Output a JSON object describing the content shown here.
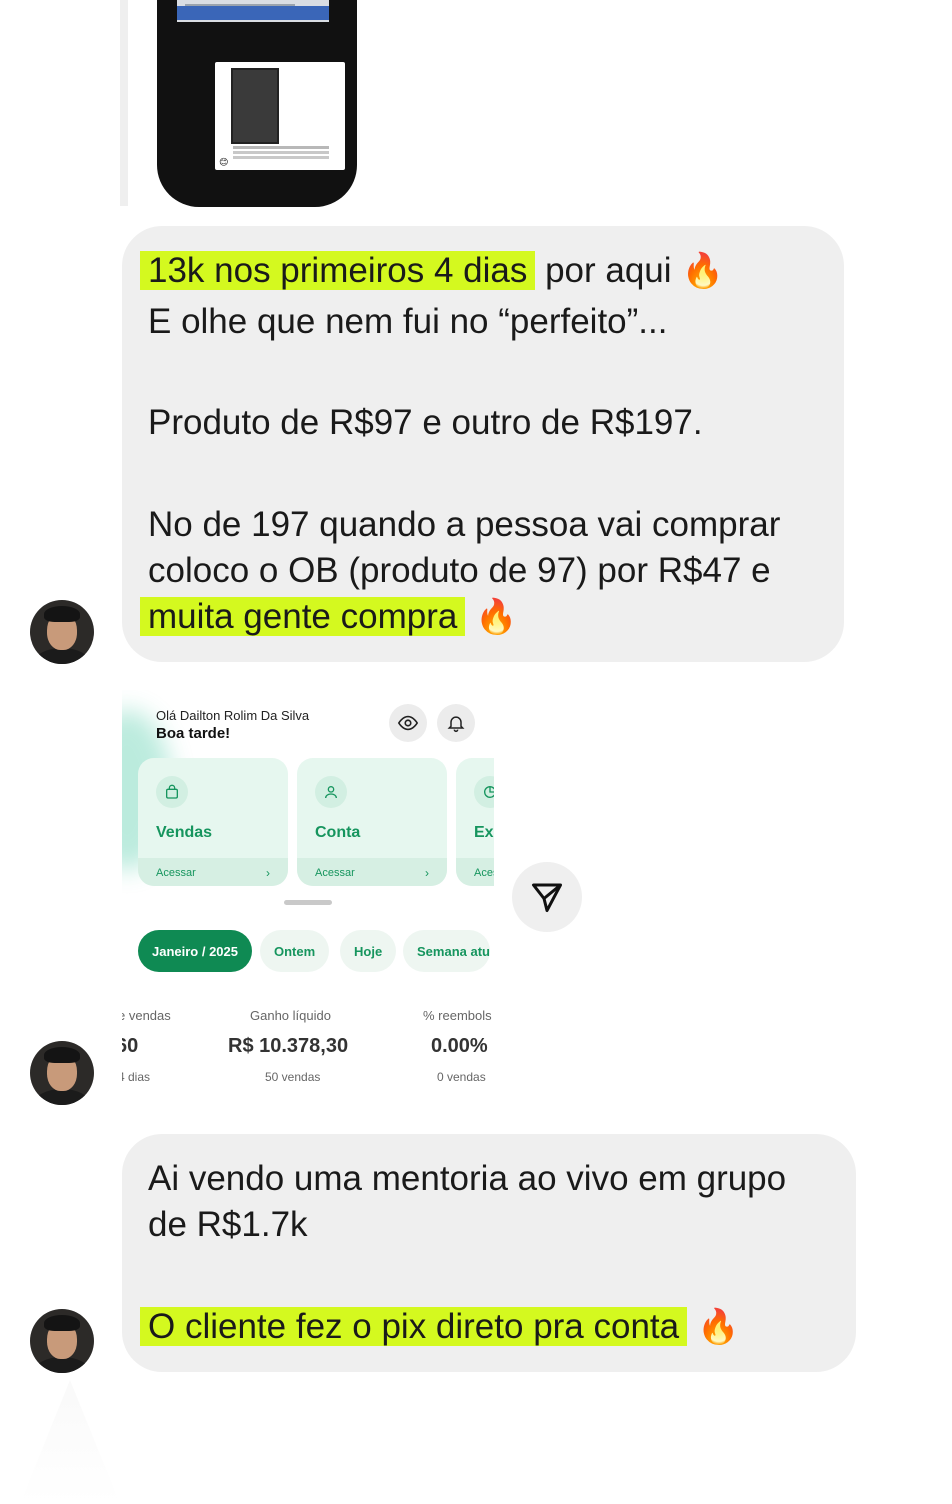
{
  "messages": {
    "m1": {
      "line1_highlight": "13k nos primeiros 4 dias",
      "line1_rest": " por aqui",
      "line2": "E olhe que nem fui no “perfeito”...",
      "line3": "Produto de R$97 e outro de R$197.",
      "line4": "No de 197 quando a pessoa vai comprar",
      "line5": "coloco o OB (produto de 97) por R$47 e",
      "line6_highlight": "muita gente compra",
      "fire_emoji": "🔥"
    },
    "m3": {
      "line1": "Ai vendo uma mentoria ao vivo em grupo",
      "line2": "de R$1.7k",
      "line3_highlight": "O cliente fez o pix direto pra conta",
      "fire_emoji": "🔥"
    }
  },
  "dashboard": {
    "greeting": "Olá Dailton Rolim Da Silva",
    "subgreeting": "Boa tarde!",
    "tiles": [
      {
        "name": "Vendas",
        "action": "Acessar",
        "icon": "bag-icon"
      },
      {
        "name": "Conta",
        "action": "Acessar",
        "icon": "user-icon"
      },
      {
        "name": "Ex",
        "action": "Aces",
        "icon": "finance-icon"
      }
    ],
    "filters": [
      "Janeiro / 2025",
      "Ontem",
      "Hoje",
      "Semana atu"
    ],
    "stats": [
      {
        "label": "e vendas",
        "value": "60",
        "sub": "4 dias"
      },
      {
        "label": "Ganho líquido",
        "value": "R$ 10.378,30",
        "sub": "50 vendas"
      },
      {
        "label": "% reembols",
        "value": "0.00%",
        "sub": "0 vendas"
      }
    ]
  },
  "colors": {
    "highlight": "#d4f91f",
    "bubble": "#efefef",
    "brand_green": "#0f8a53"
  }
}
